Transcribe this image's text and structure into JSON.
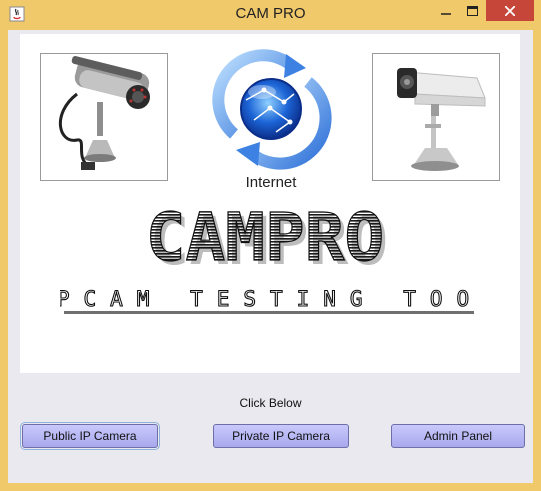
{
  "window": {
    "title": "CAM PRO",
    "minimize_glyph": "—",
    "maximize_glyph": "☐",
    "close_glyph": "✕"
  },
  "banner": {
    "globe_label": "Internet",
    "logo_text": "CAMPRO",
    "tagline": "IPCAM TESTING TOOL"
  },
  "footer": {
    "instruction": "Click Below",
    "buttons": {
      "public": "Public IP Camera",
      "private": "Private IP Camera",
      "admin": "Admin Panel"
    }
  },
  "colors": {
    "titlebar": "#f0c96b",
    "close": "#c7463a",
    "button_fill": "#b8b8f4",
    "client_bg": "#e9e9ef"
  },
  "icons": {
    "app": "java-icon",
    "left_photo": "bullet-camera-icon",
    "right_photo": "box-camera-icon",
    "globe": "internet-globe-icon"
  }
}
